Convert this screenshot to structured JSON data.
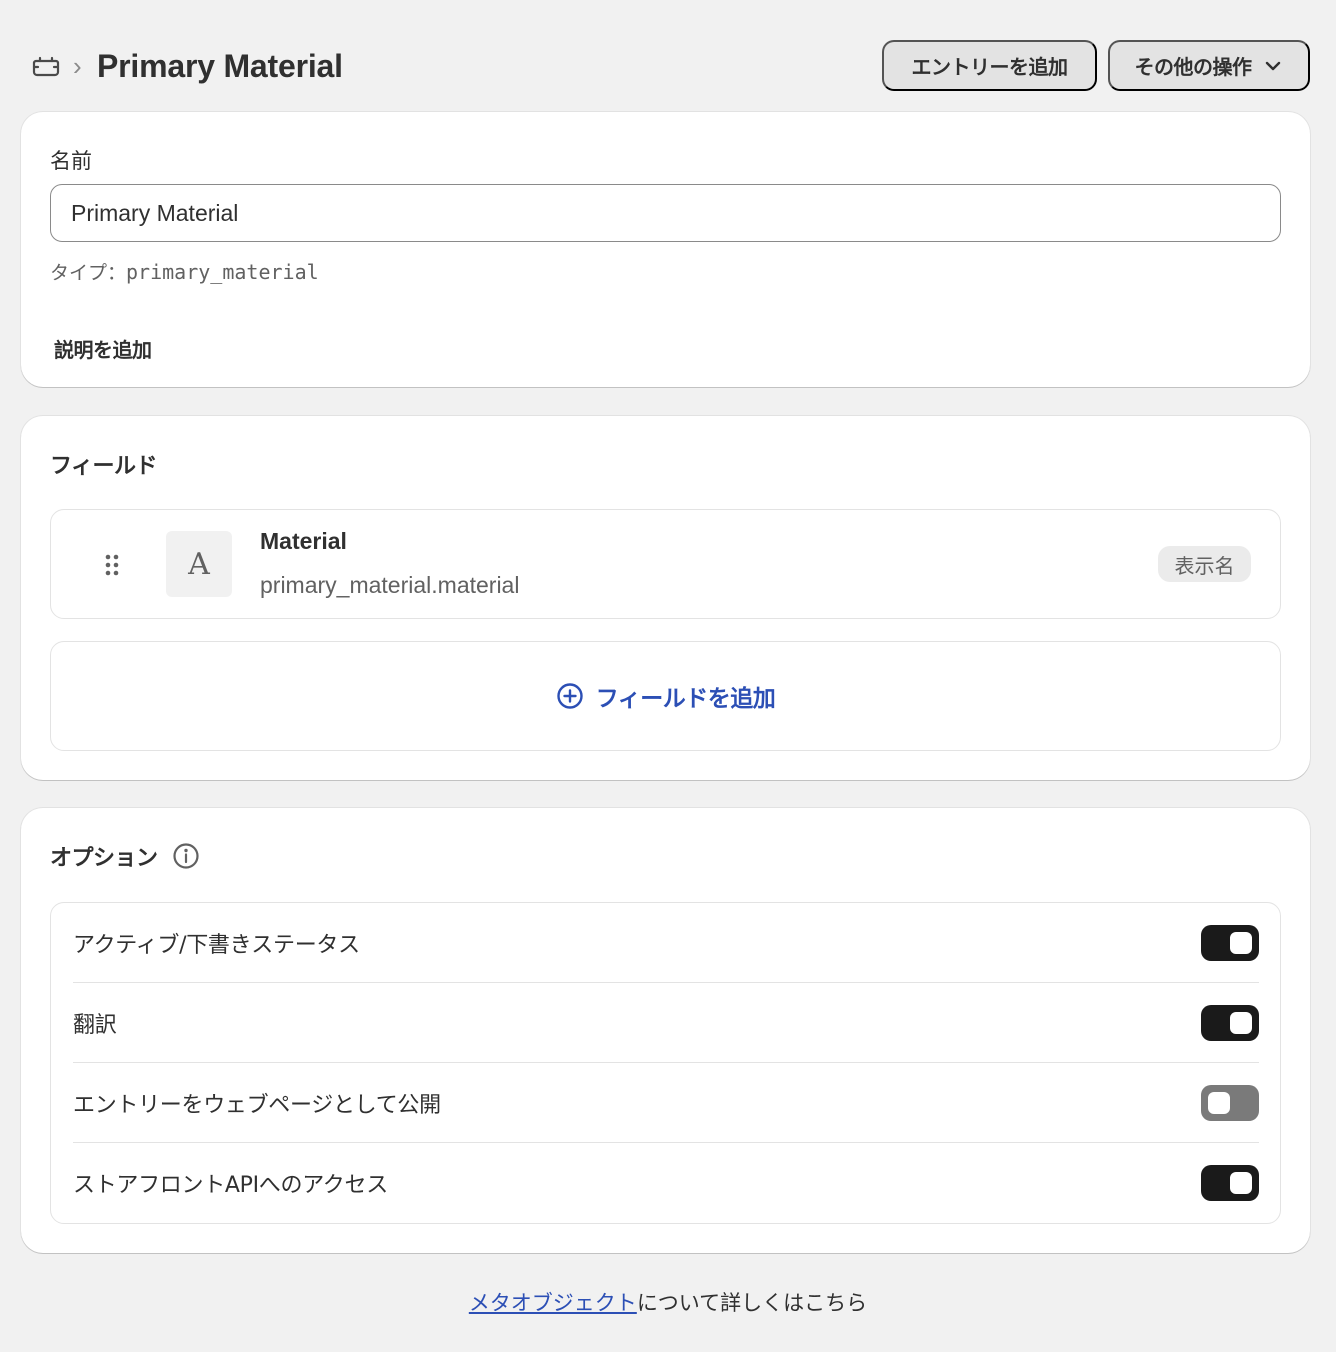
{
  "header": {
    "title": "Primary Material",
    "breadcrumb_separator": "›",
    "add_entry_label": "エントリーを追加",
    "more_actions_label": "その他の操作"
  },
  "definition": {
    "name_label": "名前",
    "name_value": "Primary Material",
    "type_label": "タイプ：",
    "type_value": "primary_material",
    "add_description_label": "説明を追加"
  },
  "fields": {
    "title": "フィールド",
    "items": [
      {
        "name": "Material",
        "key": "primary_material.material",
        "type_glyph": "A",
        "badge": "表示名"
      }
    ],
    "add_field_label": "フィールドを追加"
  },
  "options": {
    "title": "オプション",
    "items": [
      {
        "label": "アクティブ/下書きステータス",
        "enabled": true
      },
      {
        "label": "翻訳",
        "enabled": true
      },
      {
        "label": "エントリーをウェブページとして公開",
        "enabled": false
      },
      {
        "label": "ストアフロントAPIへのアクセス",
        "enabled": true
      }
    ]
  },
  "footer": {
    "link_text": "メタオブジェクト",
    "suffix_text": "について詳しくはこちら"
  },
  "colors": {
    "background": "#f1f1f1",
    "link": "#2c4fb5",
    "toggle_on": "#1a1a1a",
    "toggle_off": "#7a7a7a"
  }
}
